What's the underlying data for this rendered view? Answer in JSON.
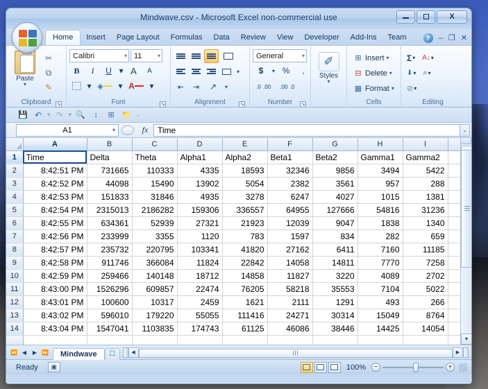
{
  "window": {
    "title": "Mindwave.csv - Microsoft Excel non-commercial use",
    "minimize": "–",
    "maximize": "□",
    "close": "X"
  },
  "office_button": {
    "label": "Office Button"
  },
  "ribbon_tabs": [
    {
      "label": "Home",
      "active": true
    },
    {
      "label": "Insert",
      "active": false
    },
    {
      "label": "Page Layout",
      "active": false
    },
    {
      "label": "Formulas",
      "active": false
    },
    {
      "label": "Data",
      "active": false
    },
    {
      "label": "Review",
      "active": false
    },
    {
      "label": "View",
      "active": false
    },
    {
      "label": "Developer",
      "active": false
    },
    {
      "label": "Add-Ins",
      "active": false
    },
    {
      "label": "Team",
      "active": false
    }
  ],
  "tab_row_right": {
    "help": "?",
    "minimize_ribbon": "–",
    "restore_ribbon": "❐",
    "close_ribbon": "✕"
  },
  "ribbon": {
    "clipboard": {
      "group_label": "Clipboard",
      "paste_label": "Paste",
      "paste_caret": "▾",
      "cut_icon": "✂",
      "copy_icon": "⧉",
      "format_painter_icon": "✎",
      "dialog_launcher": "↘"
    },
    "font": {
      "group_label": "Font",
      "font_name": "Calibri",
      "font_size": "11",
      "bold": "B",
      "italic": "I",
      "underline": "U",
      "underline_caret": "▾",
      "grow_font": "A",
      "shrink_font": "A",
      "borders_caret": "▾",
      "fill_color": "⬤",
      "fill_caret": "▾",
      "font_color": "A",
      "font_color_caret": "▾",
      "dialog_launcher": "↘"
    },
    "alignment": {
      "group_label": "Alignment",
      "top_align": "top-align",
      "middle_align": "middle-align",
      "bottom_align": "bottom-align",
      "align_left": "align-left",
      "align_center": "align-center",
      "align_right": "align-right",
      "decrease_indent": "⇤",
      "increase_indent": "⇥",
      "orientation": "↗",
      "orientation_caret": "▾",
      "wrap_text": "wrap-text",
      "merge_center": "merge-center",
      "merge_caret": "▾",
      "dialog_launcher": "↘"
    },
    "number": {
      "group_label": "Number",
      "format": "General",
      "format_caret": "▾",
      "accounting": "$",
      "accounting_caret": "▾",
      "percent": "%",
      "comma": ",",
      "increase_decimal_top": ".0",
      "increase_decimal_bottom": ".00",
      "decrease_decimal_top": ".00",
      "decrease_decimal_bottom": ".0",
      "dialog_launcher": "↘"
    },
    "styles": {
      "group_label": "Styles",
      "styles_label": "Styles",
      "styles_caret": "▾",
      "styles_icon": "✐"
    },
    "cells": {
      "group_label": "Cells",
      "insert_label": "Insert",
      "delete_label": "Delete",
      "format_label": "Format",
      "caret": "▾"
    },
    "editing": {
      "group_label": "Editing",
      "autosum": "Σ",
      "autosum_caret": "▾",
      "fill": "⬇",
      "fill_caret": "▾",
      "clear": "⊘",
      "clear_caret": "▾",
      "sort_filter": "A↓",
      "sort_caret": "▾",
      "find_select": "⌕",
      "find_caret": "▾"
    }
  },
  "quick_access": {
    "save": "💾",
    "undo": "↶",
    "undo_caret": "▾",
    "redo": "↷",
    "redo_caret": "▾",
    "print_preview": "🔍",
    "sort_asc": "↕",
    "tool3": "⊞",
    "open": "📂",
    "customize_caret": "⌄"
  },
  "formula_bar": {
    "name_box": "A1",
    "name_box_caret": "▾",
    "fx": "fx",
    "content": "Time",
    "expand_caret": "⌄"
  },
  "grid": {
    "columns": [
      "A",
      "B",
      "C",
      "D",
      "E",
      "F",
      "G",
      "H",
      "I"
    ],
    "selected_column": "A",
    "selected_row": 1,
    "active_cell": "A1",
    "rows": [
      {
        "n": 1,
        "cells": [
          "Time",
          "Delta",
          "Theta",
          "Alpha1",
          "Alpha2",
          "Beta1",
          "Beta2",
          "Gamma1",
          "Gamma2"
        ],
        "type": "text"
      },
      {
        "n": 2,
        "cells": [
          "8:42:51 PM",
          "731665",
          "110333",
          "4335",
          "18593",
          "32346",
          "9856",
          "3494",
          "5422"
        ],
        "type": "num"
      },
      {
        "n": 3,
        "cells": [
          "8:42:52 PM",
          "44098",
          "15490",
          "13902",
          "5054",
          "2382",
          "3561",
          "957",
          "288"
        ],
        "type": "num"
      },
      {
        "n": 4,
        "cells": [
          "8:42:53 PM",
          "151833",
          "31846",
          "4935",
          "3278",
          "6247",
          "4027",
          "1015",
          "1381"
        ],
        "type": "num"
      },
      {
        "n": 5,
        "cells": [
          "8:42:54 PM",
          "2315013",
          "2186282",
          "159306",
          "336557",
          "64955",
          "127666",
          "54816",
          "31236"
        ],
        "type": "num"
      },
      {
        "n": 6,
        "cells": [
          "8:42:55 PM",
          "634361",
          "52939",
          "27321",
          "21923",
          "12039",
          "9047",
          "1838",
          "1340"
        ],
        "type": "num"
      },
      {
        "n": 7,
        "cells": [
          "8:42:56 PM",
          "233999",
          "3355",
          "1120",
          "783",
          "1597",
          "834",
          "282",
          "659"
        ],
        "type": "num"
      },
      {
        "n": 8,
        "cells": [
          "8:42:57 PM",
          "235732",
          "220795",
          "103341",
          "41820",
          "27162",
          "6411",
          "7160",
          "11185"
        ],
        "type": "num"
      },
      {
        "n": 9,
        "cells": [
          "8:42:58 PM",
          "911746",
          "366084",
          "11824",
          "22842",
          "14058",
          "14811",
          "7770",
          "7258"
        ],
        "type": "num"
      },
      {
        "n": 10,
        "cells": [
          "8:42:59 PM",
          "259466",
          "140148",
          "18712",
          "14858",
          "11827",
          "3220",
          "4089",
          "2702"
        ],
        "type": "num"
      },
      {
        "n": 11,
        "cells": [
          "8:43:00 PM",
          "1526296",
          "609857",
          "22474",
          "76205",
          "58218",
          "35553",
          "7104",
          "5022"
        ],
        "type": "num"
      },
      {
        "n": 12,
        "cells": [
          "8:43:01 PM",
          "100600",
          "10317",
          "2459",
          "1621",
          "2111",
          "1291",
          "493",
          "266"
        ],
        "type": "num"
      },
      {
        "n": 13,
        "cells": [
          "8:43:02 PM",
          "596010",
          "179220",
          "55055",
          "111416",
          "24271",
          "30314",
          "15049",
          "8764"
        ],
        "type": "num"
      },
      {
        "n": 14,
        "cells": [
          "8:43:04 PM",
          "1547041",
          "1103835",
          "174743",
          "61125",
          "46086",
          "38446",
          "14425",
          "14054"
        ],
        "type": "num"
      }
    ]
  },
  "sheet_tabs": {
    "first": "⏮",
    "prev": "◀",
    "next": "▶",
    "last": "⏭",
    "tabs": [
      {
        "label": "Mindwave",
        "active": true
      }
    ],
    "insert_sheet": "➕"
  },
  "status_bar": {
    "status": "Ready",
    "zoom": "100%",
    "zoom_out": "−",
    "zoom_in": "+",
    "view_normal": "normal-view",
    "view_page_layout": "page-layout-view",
    "view_page_break": "page-break-view"
  }
}
